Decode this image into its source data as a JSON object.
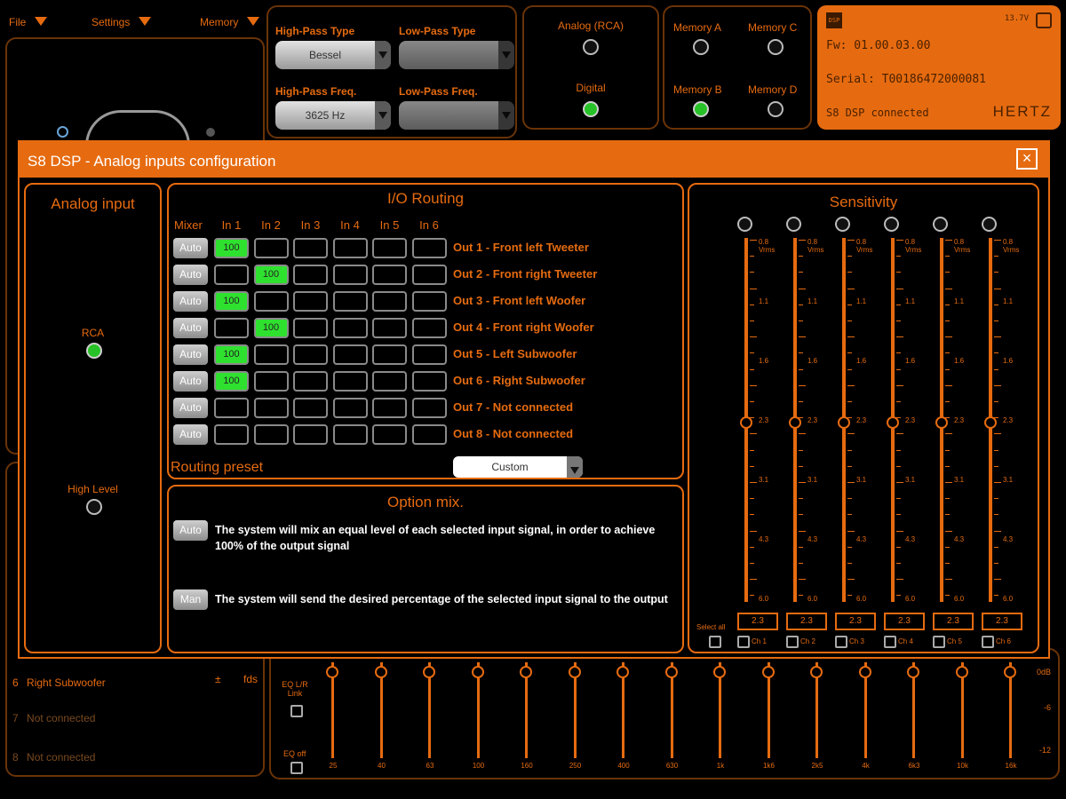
{
  "menu": {
    "file": "File",
    "settings": "Settings",
    "memory": "Memory"
  },
  "filters": {
    "hp_type_label": "High-Pass Type",
    "hp_type_value": "Bessel",
    "lp_type_label": "Low-Pass Type",
    "lp_type_value": "",
    "hp_freq_label": "High-Pass Freq.",
    "hp_freq_value": "3625 Hz",
    "lp_freq_label": "Low-Pass Freq.",
    "lp_freq_value": ""
  },
  "source": {
    "analog": "Analog (RCA)",
    "digital": "Digital"
  },
  "memories": {
    "a": "Memory A",
    "b": "Memory B",
    "c": "Memory C",
    "d": "Memory D",
    "active": "Memory B"
  },
  "device": {
    "fw": "Fw: 01.00.03.00",
    "serial": "Serial: T00186472000081",
    "status": "S8 DSP connected",
    "brand": "HERTZ",
    "voltage": "13.7V",
    "icon_label": "DSP"
  },
  "background_list": [
    {
      "num": "6",
      "label": "Right Subwoofer",
      "extra1": "±",
      "extra2": "fds"
    },
    {
      "num": "7",
      "label": "Not connected"
    },
    {
      "num": "8",
      "label": "Not connected"
    }
  ],
  "eq": {
    "link_label": "EQ L/R Link",
    "off_label": "EQ off",
    "freqs": [
      "25",
      "40",
      "63",
      "100",
      "160",
      "250",
      "400",
      "630",
      "1k",
      "1k6",
      "2k5",
      "4k",
      "6k3",
      "10k",
      "16k"
    ],
    "db_labels": [
      "0dB",
      "-6",
      "-12"
    ]
  },
  "modal": {
    "title": "S8 DSP - Analog inputs configuration",
    "close": "×",
    "analog_input": {
      "title": "Analog input",
      "rca": "RCA",
      "high_level": "High Level",
      "selected": "RCA"
    },
    "routing": {
      "title": "I/O Routing",
      "mixer": "Mixer",
      "inputs": [
        "In 1",
        "In 2",
        "In 3",
        "In 4",
        "In 5",
        "In 6"
      ],
      "rows": [
        {
          "mode": "Auto",
          "label": "Out 1 - Front left Tweeter",
          "cells": [
            "100",
            "",
            "",
            "",
            "",
            ""
          ]
        },
        {
          "mode": "Auto",
          "label": "Out 2 - Front right Tweeter",
          "cells": [
            "",
            "100",
            "",
            "",
            "",
            ""
          ]
        },
        {
          "mode": "Auto",
          "label": "Out 3 - Front left Woofer",
          "cells": [
            "100",
            "",
            "",
            "",
            "",
            ""
          ]
        },
        {
          "mode": "Auto",
          "label": "Out 4 - Front right Woofer",
          "cells": [
            "",
            "100",
            "",
            "",
            "",
            ""
          ]
        },
        {
          "mode": "Auto",
          "label": "Out 5 - Left Subwoofer",
          "cells": [
            "100",
            "",
            "",
            "",
            "",
            ""
          ]
        },
        {
          "mode": "Auto",
          "label": "Out 6 - Right Subwoofer",
          "cells": [
            "100",
            "",
            "",
            "",
            "",
            ""
          ]
        },
        {
          "mode": "Auto",
          "label": "Out 7 - Not connected",
          "cells": [
            "",
            "",
            "",
            "",
            "",
            ""
          ]
        },
        {
          "mode": "Auto",
          "label": "Out 8 - Not connected",
          "cells": [
            "",
            "",
            "",
            "",
            "",
            ""
          ]
        }
      ],
      "preset_label": "Routing preset",
      "preset_value": "Custom"
    },
    "option_mix": {
      "title": "Option mix.",
      "auto_btn": "Auto",
      "auto_text": "The system will mix an equal level of each selected input signal, in order to achieve 100% of the output signal",
      "man_btn": "Man",
      "man_text": "The system will send the desired percentage of the selected input signal to the output"
    },
    "sensitivity": {
      "title": "Sensitivity",
      "scale": [
        "0.8 Vrms",
        "1.1",
        "1.6",
        "2.3",
        "3.1",
        "4.3",
        "6.0"
      ],
      "channels": [
        {
          "name": "Ch 1",
          "value": "2.3"
        },
        {
          "name": "Ch 2",
          "value": "2.3"
        },
        {
          "name": "Ch 3",
          "value": "2.3"
        },
        {
          "name": "Ch 4",
          "value": "2.3"
        },
        {
          "name": "Ch 5",
          "value": "2.3"
        },
        {
          "name": "Ch 6",
          "value": "2.3"
        }
      ],
      "select_all": "Select all"
    }
  }
}
